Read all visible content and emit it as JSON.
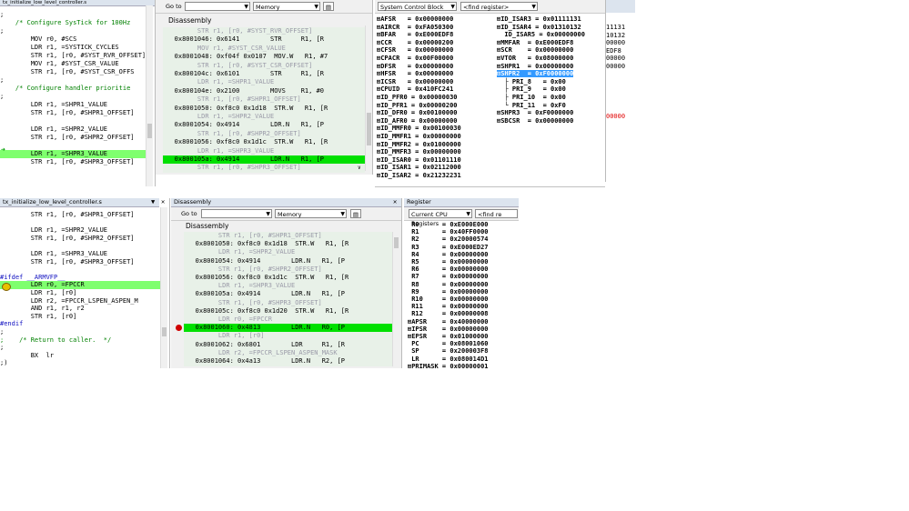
{
  "top_left_src": {
    "title": "tx_initialize_low_level_controller.s",
    "lines": [
      {
        "text": ";",
        "cls": "c-code"
      },
      {
        "text": "    /* Configure SysTick for 100Hz",
        "cls": "c-green"
      },
      {
        "text": ";",
        "cls": "c-code"
      },
      {
        "text": "        MOV r0, #SCS",
        "cls": "c-code"
      },
      {
        "text": "        LDR r1, =SYSTICK_CYCLES",
        "cls": "c-code"
      },
      {
        "text": "        STR r1, [r0, #SYST_RVR_OFFSET]",
        "cls": "c-code"
      },
      {
        "text": "        MOV r1, #SYST_CSR_VALUE",
        "cls": "c-code"
      },
      {
        "text": "        STR r1, [r0, #SYST_CSR_OFFS",
        "cls": "c-code"
      },
      {
        "text": ";",
        "cls": "c-code"
      },
      {
        "text": "    /* Configure handler prioritie",
        "cls": "c-green"
      },
      {
        "text": ";",
        "cls": "c-code"
      },
      {
        "text": "        LDR r1, =SHPR1_VALUE",
        "cls": "c-code"
      },
      {
        "text": "        STR r1, [r0, #SHPR1_OFFSET]",
        "cls": "c-code"
      },
      {
        "text": "",
        "cls": "c-code"
      },
      {
        "text": "        LDR r1, =SHPR2_VALUE",
        "cls": "c-code"
      },
      {
        "text": "        STR r1, [r0, #SHPR2_OFFSET]",
        "cls": "c-code"
      },
      {
        "text": "",
        "cls": "c-code"
      },
      {
        "text": "        LDR r1, =SHPR3_VALUE",
        "cls": "c-code hl"
      },
      {
        "text": "        STR r1, [r0, #SHPR3_OFFSET]",
        "cls": "c-code"
      }
    ]
  },
  "top_disasm": {
    "goto_label": "Go to",
    "mode": "Memory",
    "title": "Disassembly",
    "lines": [
      {
        "text": "         STR r1, [r0, #SYST_RVR_OFFSET]",
        "cls": "c-gray"
      },
      {
        "text": "   0x8001046: 0x6141        STR     R1, [R",
        "cls": "c-code"
      },
      {
        "text": "         MOV r1, #SYST_CSR_VALUE",
        "cls": "c-gray"
      },
      {
        "text": "   0x8001048: 0xf04f 0x0107  MOV.W   R1, #7",
        "cls": "c-code"
      },
      {
        "text": "         STR r1, [r0, #SYST_CSR_OFFSET]",
        "cls": "c-gray"
      },
      {
        "text": "   0x800104c: 0x6101        STR     R1, [R",
        "cls": "c-code"
      },
      {
        "text": "         LDR r1, =SHPR1_VALUE",
        "cls": "c-gray"
      },
      {
        "text": "   0x800104e: 0x2100        MOVS    R1, #0",
        "cls": "c-code"
      },
      {
        "text": "         STR r1, [r0, #SHPR1_OFFSET]",
        "cls": "c-gray"
      },
      {
        "text": "   0x8001050: 0xf8c0 0x1d18  STR.W   R1, [R",
        "cls": "c-code"
      },
      {
        "text": "         LDR r1, =SHPR2_VALUE",
        "cls": "c-gray"
      },
      {
        "text": "   0x8001054: 0x4914        LDR.N   R1, [P",
        "cls": "c-code"
      },
      {
        "text": "         STR r1, [r0, #SHPR2_OFFSET]",
        "cls": "c-gray"
      },
      {
        "text": "   0x8001056: 0xf8c0 0x1d1c  STR.W   R1, [R",
        "cls": "c-code"
      },
      {
        "text": "         LDR r1, =SHPR3_VALUE",
        "cls": "c-gray"
      },
      {
        "text": "   0x800105a: 0x4914        LDR.N   R1, [P",
        "cls": "c-code hl2"
      },
      {
        "text": "         STR r1, [r0, #SHPR3_OFFSET]",
        "cls": "c-gray"
      }
    ]
  },
  "top_scb": {
    "combo": "System Control Block",
    "find": "<find register>",
    "left": [
      "⊞AFSR   = 0x00000000",
      "⊞AIRCR  = 0xFA050300",
      "⊞BFAR   = 0xE000EDF8",
      "⊞CCR    = 0x00000200",
      "⊞CFSR   = 0x00000000",
      "⊞CPACR  = 0x00F00000",
      "⊞DFSR   = 0x00000000",
      "⊞HFSR   = 0x00000000",
      "⊞ICSR   = 0x00000000",
      "⊞CPUID  = 0x410FC241",
      "⊞ID_PFR0 = 0x00000030",
      "⊞ID_PFR1 = 0x00000200",
      "⊞ID_DFR0 = 0x00100000",
      "⊞ID_AFR0 = 0x00000000",
      "⊞ID_MMFR0 = 0x00100030",
      "⊞ID_MMFR1 = 0x00000000",
      "⊞ID_MMFR2 = 0x01000000",
      "⊞ID_MMFR3 = 0x00000000",
      "⊞ID_ISAR0 = 0x01101110",
      "⊞ID_ISAR1 = 0x02112000",
      "⊞ID_ISAR2 = 0x21232231"
    ],
    "right": [
      "⊞ID_ISAR3 = 0x01111131",
      "⊞ID_ISAR4 = 0x01310132",
      "  ID_ISAR5 = 0x00000000",
      "⊞MMFAR  = 0xE000EDF8",
      "⊞SCR    = 0x00000000",
      "⊞VTOR   = 0x08000000",
      "⊞SHPR1  = 0x00000000",
      "⊟SHPR2  = 0xF0000000",
      "  ├ PRI_8   = 0x00",
      "  ├ PRI_9   = 0x00",
      "  ├ PRI_10  = 0x00",
      "  └ PRI_11  = 0xF0",
      "⊞SHPR3  = 0xF0000000",
      "⊞SBCSR  = 0x00000000"
    ],
    "edge": [
      "11131",
      "10132",
      "00000",
      "EDF8",
      "00000",
      "00000"
    ],
    "edge_red": "00000"
  },
  "bot_src": {
    "title": "tx_initialize_low_level_controller.s",
    "lines": [
      {
        "text": "        STR r1, [r0, #SHPR1_OFFSET]",
        "cls": "c-code"
      },
      {
        "text": "",
        "cls": "c-code"
      },
      {
        "text": "        LDR r1, =SHPR2_VALUE",
        "cls": "c-code"
      },
      {
        "text": "        STR r1, [r0, #SHPR2_OFFSET]",
        "cls": "c-code"
      },
      {
        "text": "",
        "cls": "c-code"
      },
      {
        "text": "        LDR r1, =SHPR3_VALUE",
        "cls": "c-code"
      },
      {
        "text": "        STR r1, [r0, #SHPR3_OFFSET]",
        "cls": "c-code"
      },
      {
        "text": "",
        "cls": "c-code"
      },
      {
        "text": "#ifdef __ARMVFP__",
        "cls": "c-blue"
      },
      {
        "text": "        LDR r0, =FPCCR",
        "cls": "c-code hl"
      },
      {
        "text": "        LDR r1, [r0]",
        "cls": "c-code"
      },
      {
        "text": "        LDR r2, =FPCCR_LSPEN_ASPEN_M",
        "cls": "c-code"
      },
      {
        "text": "        AND r1, r1, r2",
        "cls": "c-code"
      },
      {
        "text": "        STR r1, [r0]",
        "cls": "c-code"
      },
      {
        "text": "#endif",
        "cls": "c-blue"
      },
      {
        "text": ";",
        "cls": "c-code"
      },
      {
        "text": ";    /* Return to caller.  */",
        "cls": "c-green"
      },
      {
        "text": ";",
        "cls": "c-code"
      },
      {
        "text": "        BX  lr",
        "cls": "c-code"
      },
      {
        "text": ";)",
        "cls": "c-code"
      }
    ]
  },
  "bot_disasm": {
    "panel_title": "Disassembly",
    "goto_label": "Go to",
    "mode": "Memory",
    "title": "Disassembly",
    "lines": [
      {
        "text": "         STR r1, [r0, #SHPR1_OFFSET]",
        "cls": "c-gray"
      },
      {
        "text": "   0x8001050: 0xf8c0 0x1d18  STR.W   R1, [R",
        "cls": "c-code"
      },
      {
        "text": "         LDR r1, =SHPR2_VALUE",
        "cls": "c-gray"
      },
      {
        "text": "   0x8001054: 0x4914        LDR.N   R1, [P",
        "cls": "c-code"
      },
      {
        "text": "         STR r1, [r0, #SHPR2_OFFSET]",
        "cls": "c-gray"
      },
      {
        "text": "   0x8001056: 0xf8c0 0x1d1c  STR.W   R1, [R",
        "cls": "c-code"
      },
      {
        "text": "         LDR r1, =SHPR3_VALUE",
        "cls": "c-gray"
      },
      {
        "text": "   0x800105a: 0x4914        LDR.N   R1, [P",
        "cls": "c-code"
      },
      {
        "text": "         STR r1, [r0, #SHPR3_OFFSET]",
        "cls": "c-gray"
      },
      {
        "text": "   0x800105c: 0xf8c0 0x1d20  STR.W   R1, [R",
        "cls": "c-code"
      },
      {
        "text": "         LDR r0, =FPCCR",
        "cls": "c-gray"
      },
      {
        "text": "   0x8001060: 0x4813        LDR.N   R0, [P",
        "cls": "c-code hl2"
      },
      {
        "text": "         LDR r1, [r0]",
        "cls": "c-gray"
      },
      {
        "text": "   0x8001062: 0x6801        LDR     R1, [R",
        "cls": "c-code"
      },
      {
        "text": "         LDR r2, =FPCCR_LSPEN_ASPEN_MASK",
        "cls": "c-gray"
      },
      {
        "text": "   0x8001064: 0x4a13        LDR.N   R2, [P",
        "cls": "c-code"
      }
    ]
  },
  "bot_regs": {
    "panel_title": "Register",
    "combo": "Current CPU Registers",
    "find": "<find re",
    "rows": [
      " R0      = 0xE000E000",
      " R1      = 0x40FF0000",
      " R2      = 0x20000574",
      " R3      = 0xE000ED27",
      " R4      = 0x00000000",
      " R5      = 0x00000000",
      " R6      = 0x00000000",
      " R7      = 0x00000000",
      " R8      = 0x00000000",
      " R9      = 0x00000000",
      " R10     = 0x00000000",
      " R11     = 0x00000000",
      " R12     = 0x00000008",
      "⊞APSR    = 0x40000000",
      "⊞IPSR    = 0x00000000",
      "⊞EPSR    = 0x01000000",
      " PC      = 0x08001060",
      " SP      = 0x200003F8",
      " LR      = 0x080014D1",
      "⊞PRIMASK = 0x00000001"
    ]
  }
}
